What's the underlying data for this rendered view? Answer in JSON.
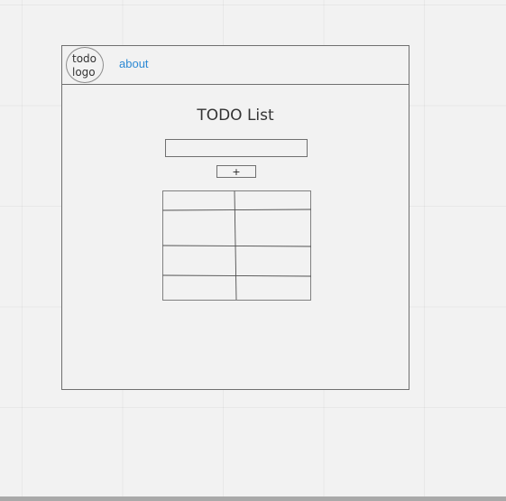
{
  "navbar": {
    "logo_text": "todo\nlogo",
    "about_label": "about"
  },
  "main": {
    "title": "TODO List",
    "input_value": "",
    "input_placeholder": "",
    "add_button_label": "+"
  },
  "table": {
    "rows": [
      [
        "",
        ""
      ],
      [
        "",
        ""
      ],
      [
        "",
        ""
      ],
      [
        "",
        ""
      ]
    ]
  },
  "colors": {
    "background": "#f2f2f2",
    "border": "#707070",
    "link": "#2d8ad4",
    "text": "#333333"
  }
}
